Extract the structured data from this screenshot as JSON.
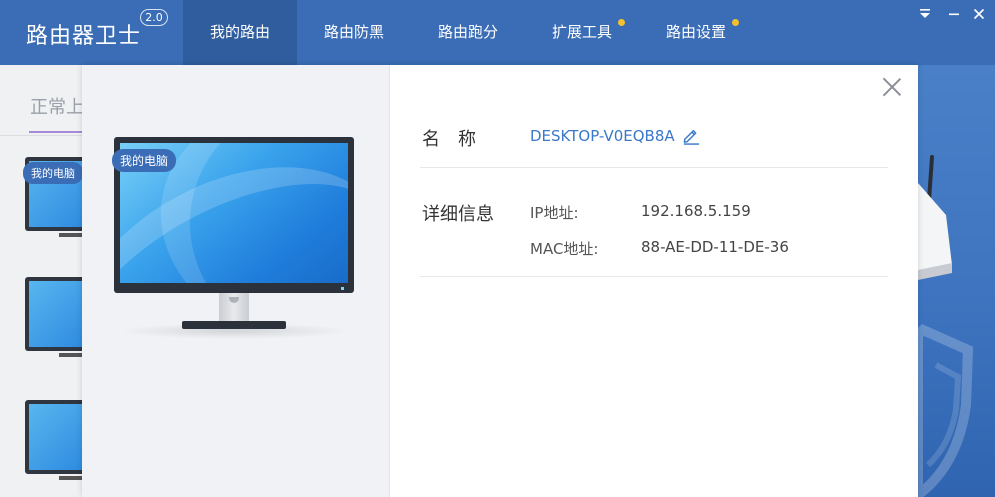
{
  "app": {
    "title": "路由器卫士",
    "version": "2.0"
  },
  "nav": {
    "tabs": [
      {
        "label": "我的路由",
        "active": true,
        "dot": false
      },
      {
        "label": "路由防黑",
        "active": false,
        "dot": false
      },
      {
        "label": "路由跑分",
        "active": false,
        "dot": false
      },
      {
        "label": "扩展工具",
        "active": false,
        "dot": true
      },
      {
        "label": "路由设置",
        "active": false,
        "dot": true
      }
    ]
  },
  "window_controls": {
    "menu_icon": "dropdown-menu-icon",
    "minimize_icon": "minimize-icon",
    "close_icon": "close-icon"
  },
  "background": {
    "status_text": "正常上",
    "device_badge": "我的电脑"
  },
  "dialog": {
    "device_badge": "我的电脑",
    "name_label": "名称",
    "device_name": "DESKTOP-V0EQB8A",
    "detail_label": "详细信息",
    "ip_key": "IP地址:",
    "ip_value": "192.168.5.159",
    "mac_key": "MAC地址:",
    "mac_value": "88-AE-DD-11-DE-36"
  },
  "colors": {
    "header_bg": "#3a6db6",
    "active_tab_bg": "#2f5d9e",
    "accent_link": "#3a78c9",
    "dot": "#f3c12d"
  }
}
